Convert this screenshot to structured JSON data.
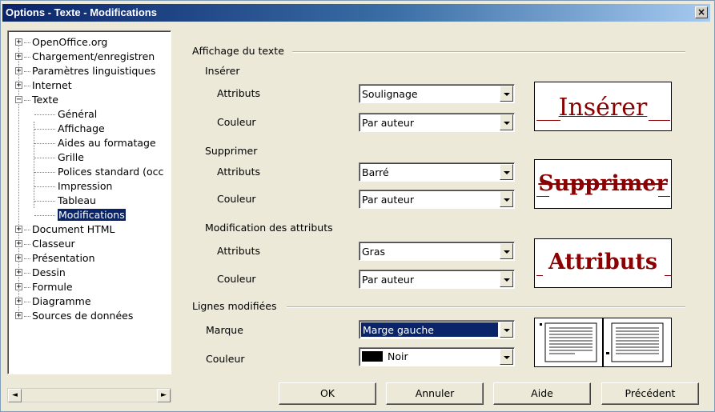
{
  "window": {
    "title": "Options - Texte - Modifications",
    "close_glyph": "×"
  },
  "tree": {
    "items": [
      {
        "label": "OpenOffice.org",
        "expander": "+"
      },
      {
        "label": "Chargement/enregistren",
        "expander": "+"
      },
      {
        "label": "Paramètres linguistiques",
        "expander": "+"
      },
      {
        "label": "Internet",
        "expander": "+"
      },
      {
        "label": "Texte",
        "expander": "−"
      },
      {
        "label": "Général"
      },
      {
        "label": "Affichage"
      },
      {
        "label": "Aides au formatage"
      },
      {
        "label": "Grille"
      },
      {
        "label": "Polices standard (occ"
      },
      {
        "label": "Impression"
      },
      {
        "label": "Tableau"
      },
      {
        "label": "Modifications",
        "selected": true
      },
      {
        "label": "Document HTML",
        "expander": "+"
      },
      {
        "label": "Classeur",
        "expander": "+"
      },
      {
        "label": "Présentation",
        "expander": "+"
      },
      {
        "label": "Dessin",
        "expander": "+"
      },
      {
        "label": "Formule",
        "expander": "+"
      },
      {
        "label": "Diagramme",
        "expander": "+"
      },
      {
        "label": "Sources de données",
        "expander": "+"
      }
    ],
    "scroll_left_glyph": "◄",
    "scroll_right_glyph": "►"
  },
  "affichage": {
    "title": "Affichage du texte",
    "inserer": {
      "title": "Insérer",
      "attr_label": "Attributs",
      "attr_value": "Soulignage",
      "color_label": "Couleur",
      "color_value": "Par auteur",
      "preview": "Insérer"
    },
    "supprimer": {
      "title": "Supprimer",
      "attr_label": "Attributs",
      "attr_value": "Barré",
      "color_label": "Couleur",
      "color_value": "Par auteur",
      "preview": "Supprimer"
    },
    "modif_attr": {
      "title": "Modification des attributs",
      "attr_label": "Attributs",
      "attr_value": "Gras",
      "color_label": "Couleur",
      "color_value": "Par auteur",
      "preview": "Attributs"
    }
  },
  "lignes": {
    "title": "Lignes modifiées",
    "marque_label": "Marque",
    "marque_value": "Marge gauche",
    "color_label": "Couleur",
    "color_value": "Noir",
    "swatch_color": "#000000"
  },
  "buttons": {
    "ok": "OK",
    "annuler": "Annuler",
    "aide": "Aide",
    "precedent": "Précédent"
  },
  "colors": {
    "preview_text": "#8b0000",
    "selection": "#0a246a",
    "dialog_bg": "#ece9d8"
  }
}
